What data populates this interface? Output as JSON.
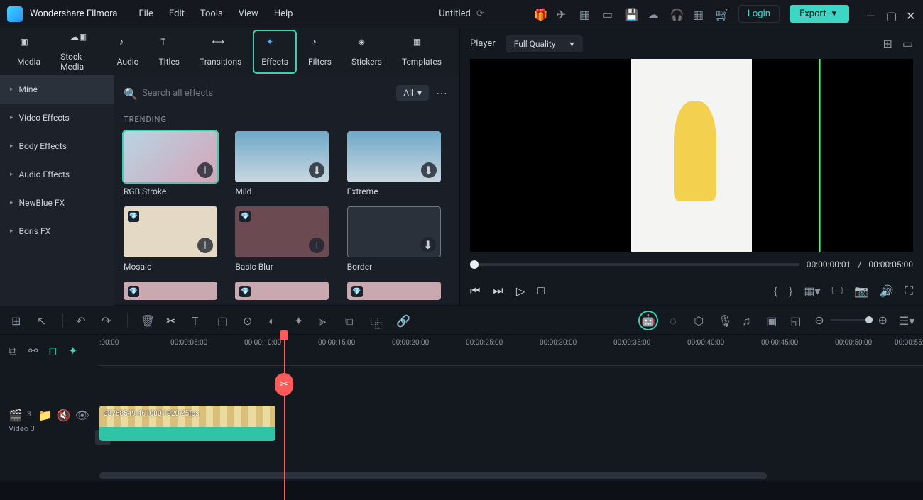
{
  "app_title": "Wondershare Filmora",
  "menu": [
    "File",
    "Edit",
    "Tools",
    "View",
    "Help"
  ],
  "document_title": "Untitled",
  "login_label": "Login",
  "export_label": "Export",
  "library_tabs": [
    "Media",
    "Stock Media",
    "Audio",
    "Titles",
    "Transitions",
    "Effects",
    "Filters",
    "Stickers",
    "Templates"
  ],
  "library_active_tab": "Effects",
  "side_categories": [
    "Mine",
    "Video Effects",
    "Body Effects",
    "Audio Effects",
    "NewBlue FX",
    "Boris FX"
  ],
  "side_selected": "Mine",
  "search_placeholder": "Search all effects",
  "filter_label": "All",
  "section_title": "TRENDING",
  "effects": [
    "RGB Stroke",
    "Mild",
    "Extreme",
    "Mosaic",
    "Basic Blur",
    "Border"
  ],
  "player_label": "Player",
  "quality_label": "Full Quality",
  "time_current": "00:00:00:01",
  "time_sep": "/",
  "time_total": "00:00:05:00",
  "ruler_ticks": [
    ":00:00",
    "00:00:05:00",
    "00:00:10:00",
    "00:00:15:00",
    "00:00:20:00",
    "00:00:25:00",
    "00:00:30:00",
    "00:00:35:00",
    "00:00:40:00",
    "00:00:45:00",
    "00:00:50:00",
    "00:00:55:0"
  ],
  "track_badge": "3",
  "track_name": "Video 3",
  "clip_label": "33768549-461080 1920 25fps"
}
